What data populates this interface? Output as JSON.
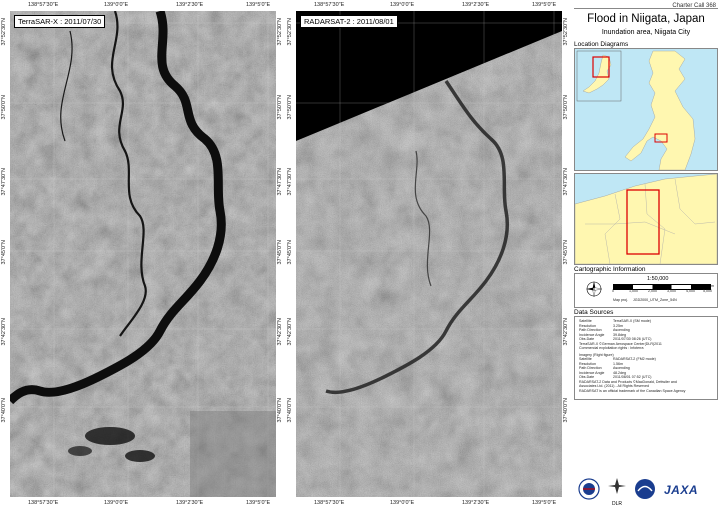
{
  "left_panel": {
    "label": "TerraSAR-X : 2011/07/30",
    "top_coords": [
      "138°57'30\"E",
      "139°0'0\"E",
      "139°2'30\"E",
      "139°5'0\"E"
    ],
    "bottom_coords": [
      "138°57'30\"E",
      "139°0'0\"E",
      "139°2'30\"E",
      "139°5'0\"E"
    ],
    "left_coords": [
      "37°52'30\"N",
      "37°50'0\"N",
      "37°47'30\"N",
      "37°45'0\"N",
      "37°42'30\"N",
      "37°40'0\"N"
    ],
    "right_coords": [
      "37°52'30\"N",
      "37°50'0\"N",
      "37°47'30\"N",
      "37°45'0\"N",
      "37°42'30\"N",
      "37°40'0\"N"
    ]
  },
  "right_panel": {
    "label": "RADARSAT-2 : 2011/08/01",
    "top_coords": [
      "138°57'30\"E",
      "139°0'0\"E",
      "139°2'30\"E",
      "139°5'0\"E"
    ],
    "bottom_coords": [
      "138°57'30\"E",
      "139°0'0\"E",
      "139°2'30\"E",
      "139°5'0\"E"
    ],
    "left_coords": [
      "37°52'30\"N",
      "37°50'0\"N",
      "37°47'30\"N",
      "37°45'0\"N",
      "37°42'30\"N",
      "37°40'0\"N"
    ],
    "right_coords": [
      "37°52'30\"N",
      "37°50'0\"N",
      "37°47'30\"N",
      "37°45'0\"N",
      "37°42'30\"N",
      "37°40'0\"N"
    ]
  },
  "sidebar": {
    "charter_call": "Charter Call 368",
    "title": "Flood in Niigata, Japan",
    "subtitle": "Inundation area, Niigata City",
    "location_header": "Location Diagrams",
    "cartographic_header": "Cartographic Information",
    "scale": "1:50,000",
    "scale_ticks": [
      "0",
      "1,000",
      "2,000",
      "3,000",
      "4,000",
      "5,000"
    ],
    "scale_unit": "m",
    "map_proj": "Map proj.",
    "map_proj_value": "JGD2000_UTM_Zone_54N",
    "data_sources_header": "Data Sources",
    "imagery_1": [
      {
        "k": "Satellite",
        "v": "TerraSAR-X (SM mode)"
      },
      {
        "k": "Resolution",
        "v": "3.25m"
      },
      {
        "k": "Path Direction",
        "v": "Ascending"
      },
      {
        "k": "Incidence Angle",
        "v": "39.8deg"
      },
      {
        "k": "Obs.Date",
        "v": "2011/07/30 08:26 (UTC)"
      }
    ],
    "imagery_1_note": "TerraSAR-X ©German Aerospace Center(DLR)2011",
    "imagery_1_note2": "Commercial exploitation rights : Infoterra",
    "imagery_2_header": "Imagery (Right figure)",
    "imagery_2": [
      {
        "k": "Satellite",
        "v": "RADARSAT-2 (FM2 mode)"
      },
      {
        "k": "Resolution",
        "v": "1.56m"
      },
      {
        "k": "Path Direction",
        "v": "Ascending"
      },
      {
        "k": "Incidence Angle",
        "v": "48.2deg"
      },
      {
        "k": "Obs.Date",
        "v": "2011/08/01 07:52 (UTC)"
      }
    ],
    "imagery_2_note": "RADARSAT-2 Data and Products ©MacDonald, Dettwiler and",
    "imagery_2_note2": "Associates Ltd. (2011) - All Rights Reserved",
    "imagery_2_note3": "RADARSAT is an official trademark of the Canadian Space Agency",
    "logos": [
      "DLR",
      "JAXA"
    ]
  }
}
